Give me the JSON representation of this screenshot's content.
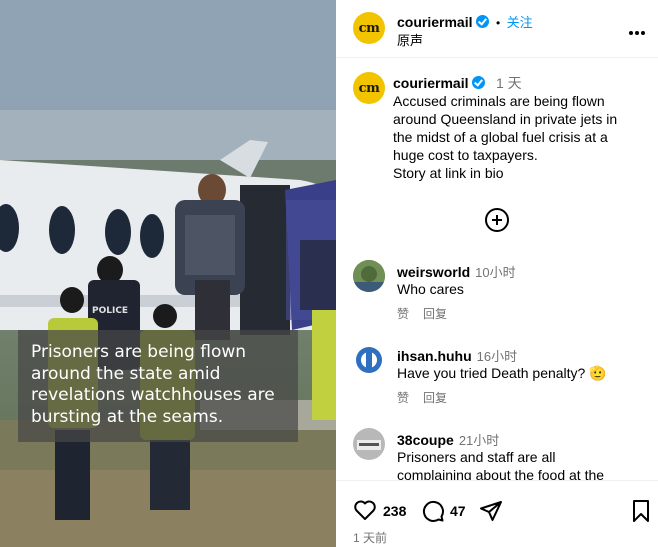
{
  "media": {
    "overlay_caption": "Prisoners are being flown around the state amid revelations watchhouses are bursting at the seams.",
    "overlay_lines": [
      "Prisoners are being flown",
      "around the state amid",
      "revelations watchhouses are",
      "bursting at the seams."
    ],
    "police_label": "POLICE"
  },
  "header": {
    "username": "couriermail",
    "avatar_text": "cm",
    "follow_label": "关注",
    "separator": "•",
    "subtitle": "原声",
    "more_icon": "more-horizontal-icon",
    "more_label": "•••"
  },
  "post_caption": {
    "username": "couriermail",
    "avatar_text": "cm",
    "time": "1 天",
    "lines": [
      "Accused criminals are being flown",
      "around Queensland in private jets in",
      "the midst of a global fuel crisis at a",
      "huge cost to taxpayers.",
      "Story at link in bio"
    ]
  },
  "comments": [
    {
      "username": "weirsworld",
      "time": "10小时",
      "text": "Who cares",
      "like_label": "赞",
      "reply_label": "回复"
    },
    {
      "username": "ihsan.huhu",
      "time": "16小时",
      "text": "Have you tried Death penalty? 🫡",
      "like_label": "赞",
      "reply_label": "回复"
    },
    {
      "username": "38coupe",
      "time": "21小时",
      "text_lines": [
        "Prisoners and staff are all",
        "complaining about the food at the"
      ]
    }
  ],
  "actions": {
    "like_count": "238",
    "comment_count": "47",
    "date": "1 天前"
  },
  "colors": {
    "accent": "#0095f6",
    "brand_yellow": "#f2c400",
    "muted_text": "#737373"
  }
}
